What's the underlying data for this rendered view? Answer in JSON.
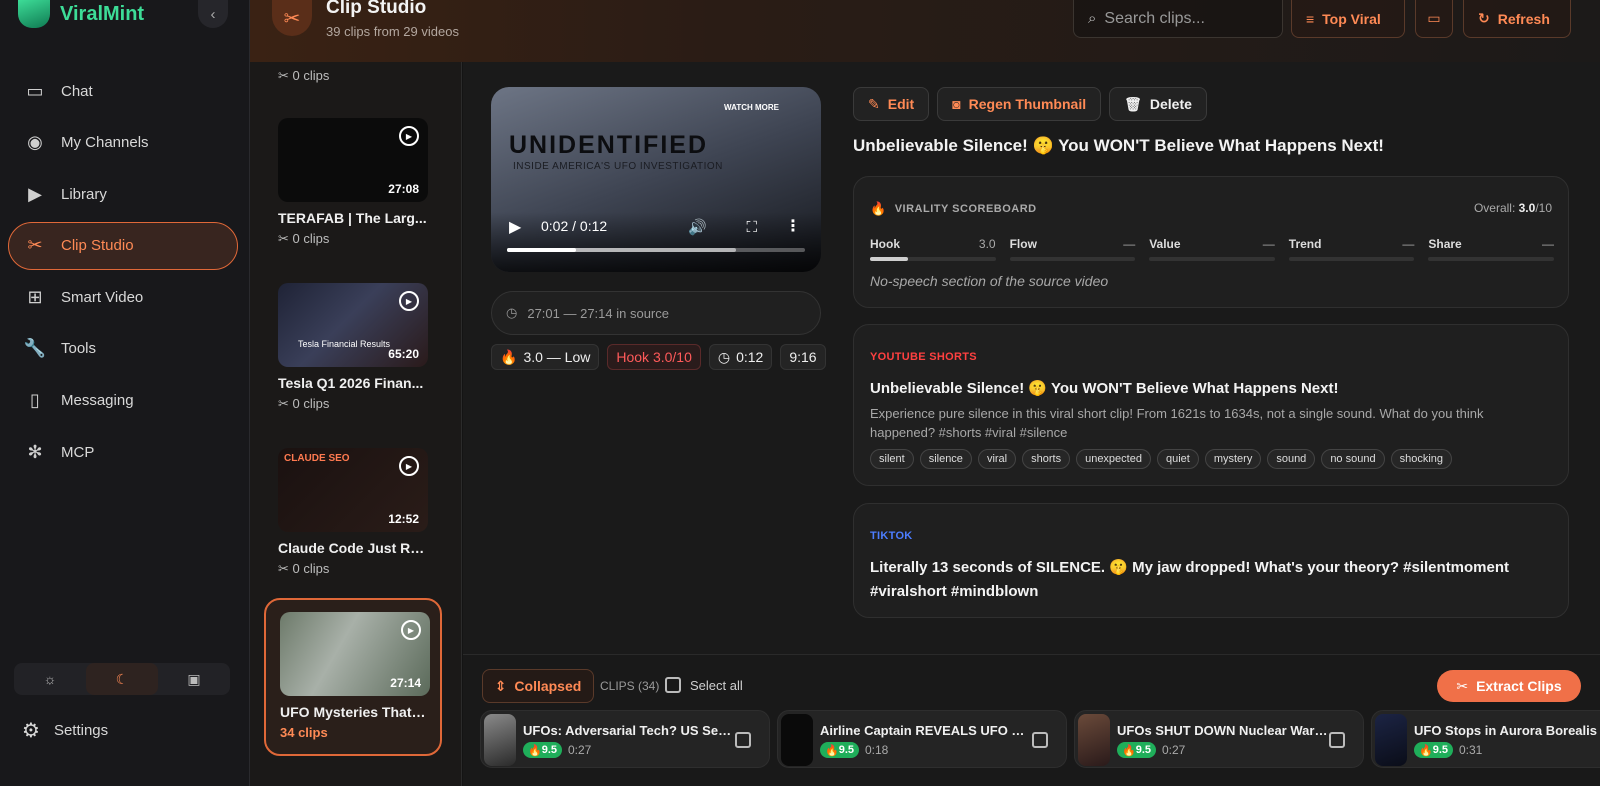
{
  "brand": {
    "name": "ViralMint"
  },
  "nav": {
    "items": [
      {
        "label": "Chat",
        "icon": "chat-icon"
      },
      {
        "label": "My Channels",
        "icon": "broadcast-icon"
      },
      {
        "label": "Library",
        "icon": "library-icon"
      },
      {
        "label": "Clip Studio",
        "icon": "scissors-icon"
      },
      {
        "label": "Smart Video",
        "icon": "add-video-icon"
      },
      {
        "label": "Tools",
        "icon": "wrench-icon"
      },
      {
        "label": "Messaging",
        "icon": "phone-icon"
      },
      {
        "label": "MCP",
        "icon": "network-icon"
      }
    ],
    "settings_label": "Settings"
  },
  "header": {
    "title": "Clip Studio",
    "subtitle": "39 clips from 29 videos",
    "search_placeholder": "Search clips...",
    "sort_label": "Top Viral",
    "refresh_label": "Refresh"
  },
  "sources": {
    "top_clips": "0 clips",
    "items": [
      {
        "title": "TERAFAB | The Larg...",
        "duration": "27:08",
        "clips": "0 clips"
      },
      {
        "title": "Tesla Q1 2026 Finan...",
        "duration": "65:20",
        "clips": "0 clips",
        "thumb_text": "Tesla Financial Results"
      },
      {
        "title": "Claude Code Just Re...",
        "duration": "12:52",
        "clips": "0 clips",
        "thumb_text": "CLAUDE SEO"
      },
      {
        "title": "UFO Mysteries That ...",
        "duration": "27:14",
        "clips": "34 clips"
      }
    ]
  },
  "player": {
    "title_overlay": "UNIDENTIFIED",
    "subtitle_overlay": "INSIDE AMERICA'S UFO INVESTIGATION",
    "watermark": "WATCH MORE",
    "time": "0:02 / 0:12",
    "progress_fraction": 0.23,
    "buffered_fraction": 0.77
  },
  "clip": {
    "source_range": "27:01 — 27:14 in source",
    "virality_chip": "3.0 — Low",
    "hook_chip": "Hook 3.0/10",
    "duration_chip": "0:12",
    "aspect_chip": "9:16",
    "actions": {
      "edit": "Edit",
      "regen": "Regen Thumbnail",
      "delete": "Delete"
    },
    "title": "Unbelievable Silence! 🤫 You WON'T Believe What Happens Next!"
  },
  "scoreboard": {
    "heading": "VIRALITY SCOREBOARD",
    "overall_label": "Overall:",
    "overall_value": "3.0",
    "overall_suffix": "/10",
    "metrics": [
      {
        "name": "Hook",
        "value": "3.0",
        "fraction": 0.3
      },
      {
        "name": "Flow",
        "value": "—",
        "fraction": 0
      },
      {
        "name": "Value",
        "value": "—",
        "fraction": 0
      },
      {
        "name": "Trend",
        "value": "—",
        "fraction": 0
      },
      {
        "name": "Share",
        "value": "—",
        "fraction": 0
      }
    ],
    "note": "No-speech section of the source video"
  },
  "youtube": {
    "platform": "YOUTUBE SHORTS",
    "title": "Unbelievable Silence! 🤫 You WON'T Believe What Happens Next!",
    "description": "Experience pure silence in this viral short clip! From 1621s to 1634s, not a single sound. What do you think happened? #shorts #viral #silence",
    "tags": [
      "silent",
      "silence",
      "viral",
      "shorts",
      "unexpected",
      "quiet",
      "mystery",
      "sound",
      "no sound",
      "shocking"
    ]
  },
  "tiktok": {
    "platform": "TIKTOK",
    "caption": "Literally 13 seconds of SILENCE. 🤫 My jaw dropped! What's your theory? #silentmoment #viralshort #mindblown"
  },
  "tray": {
    "collapsed_label": "Collapsed",
    "clips_count": "CLIPS (34)",
    "select_all": "Select all",
    "extract_label": "Extract Clips",
    "clips": [
      {
        "title": "UFOs: Adversarial Tech? US Secur...",
        "score": "9.5",
        "duration": "0:27"
      },
      {
        "title": "Airline Captain REVEALS UFO Sigh...",
        "score": "9.5",
        "duration": "0:18"
      },
      {
        "title": "UFOs SHUT DOWN Nuclear Warhe...",
        "score": "9.5",
        "duration": "0:27"
      },
      {
        "title": "UFO Stops in Aurora Borealis",
        "score": "9.5",
        "duration": "0:31"
      }
    ]
  },
  "colors": {
    "accent": "#e06838",
    "brand": "#3ddc97",
    "score_green": "#1fae5a"
  }
}
